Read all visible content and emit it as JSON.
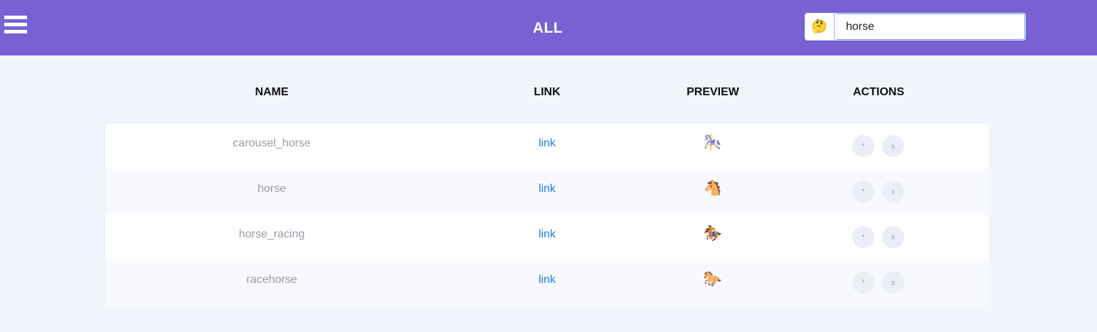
{
  "header": {
    "title": "ALL",
    "search": {
      "emoji": "🤔",
      "value": "horse",
      "placeholder": ""
    }
  },
  "table": {
    "columns": [
      "NAME",
      "LINK",
      "PREVIEW",
      "ACTIONS"
    ],
    "rows": [
      {
        "name": "carousel_horse",
        "link": "link",
        "preview": "🎠",
        "action_star": "*",
        "action_x": "x"
      },
      {
        "name": "horse",
        "link": "link",
        "preview": "🐴",
        "action_star": "*",
        "action_x": "x"
      },
      {
        "name": "horse_racing",
        "link": "link",
        "preview": "🏇",
        "action_star": "*",
        "action_x": "x"
      },
      {
        "name": "racehorse",
        "link": "link",
        "preview": "🐎",
        "action_star": "*",
        "action_x": "x"
      }
    ]
  },
  "colors": {
    "header_bg": "#7761d3",
    "page_bg": "#f0f4fb",
    "link": "#1e7fe0",
    "name_text": "#9b9ba5",
    "action_bg": "#ebedf7"
  }
}
